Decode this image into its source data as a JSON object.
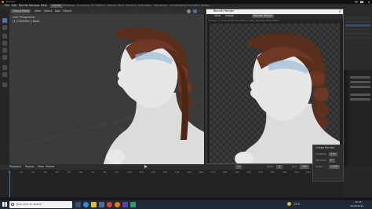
{
  "window": {
    "title": "Blender"
  },
  "menu": [
    "File",
    "Edit",
    "Render",
    "Window",
    "Help"
  ],
  "workspaces": [
    "Layout",
    "Modeling",
    "Sculpting",
    "UV Editing",
    "Texture Paint",
    "Shading",
    "Animation",
    "Rendering",
    "Compositing",
    "Geometry Nodes",
    "Scripting"
  ],
  "viewport": {
    "mode": "Object Mode",
    "header_items": [
      "View",
      "Select",
      "Add",
      "Object"
    ],
    "overlay_line1": "User Perspective",
    "overlay_line2": "(1) Collection | Base"
  },
  "render_window": {
    "title": "Blender Render",
    "menu": [
      "View",
      "Image"
    ],
    "slot": "Render Result",
    "info": "Frame:1 | Time:00:16.74 | Mem:1.18G | Sample 1024/1024"
  },
  "timeline": {
    "items": [
      "Playback",
      "Keying",
      "View",
      "Marker"
    ],
    "start_label": "Start",
    "start": "1",
    "end_label": "End",
    "end": "250",
    "frame": "1",
    "ruler": [
      "0",
      "10",
      "20",
      "30",
      "40",
      "50",
      "60",
      "70",
      "80",
      "90",
      "100",
      "110",
      "120",
      "130",
      "140",
      "150",
      "160",
      "170",
      "180",
      "190",
      "200",
      "210",
      "220",
      "230",
      "240",
      "250"
    ]
  },
  "redo_panel": {
    "title": "Linked Render",
    "rows": [
      {
        "label": "Location",
        "value": "0 m"
      },
      {
        "label": "Rotation",
        "value": "0°"
      },
      {
        "label": "Scale",
        "value": "1.000"
      }
    ]
  },
  "taskbar": {
    "search_placeholder": "Type here to search",
    "weather": "12°C",
    "time": "16:34",
    "date": "04/06/2024"
  },
  "colors": {
    "accent": "#4772b3",
    "taskbar": "#1e2a3a",
    "viewport": "#3b3b3b"
  }
}
